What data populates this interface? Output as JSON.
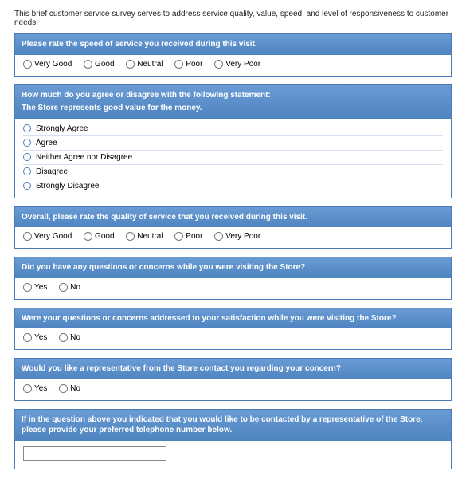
{
  "intro": "This brief customer service survey serves to address service quality, value, speed, and level of responsiveness to customer needs.",
  "q1": {
    "prompt": "Please rate the speed of service you received during this visit.",
    "opts": [
      "Very Good",
      "Good",
      "Neutral",
      "Poor",
      "Very Poor"
    ]
  },
  "q2": {
    "prompt": "How much do you agree or disagree with the following statement:",
    "prompt2": "The Store represents good value for the money.",
    "opts": [
      "Strongly Agree",
      "Agree",
      "Neither Agree nor Disagree",
      "Disagree",
      "Strongly Disagree"
    ]
  },
  "q3": {
    "prompt": "Overall, please rate the quality of service that you received during this visit.",
    "opts": [
      "Very Good",
      "Good",
      "Neutral",
      "Poor",
      "Very Poor"
    ]
  },
  "q4": {
    "prompt": "Did you have any questions or concerns while you were visiting the Store?",
    "opts": [
      "Yes",
      "No"
    ]
  },
  "q5": {
    "prompt": "Were your questions or concerns addressed to your satisfaction while you were visiting the Store?",
    "opts": [
      "Yes",
      "No"
    ]
  },
  "q6": {
    "prompt": "Would you like a representative from the Store contact you regarding your concern?",
    "opts": [
      "Yes",
      "No"
    ]
  },
  "q7": {
    "prompt": "If in the question above you indicated that you would like to be contacted by a representative of the Store, please provide your preferred telephone number below.",
    "value": ""
  }
}
